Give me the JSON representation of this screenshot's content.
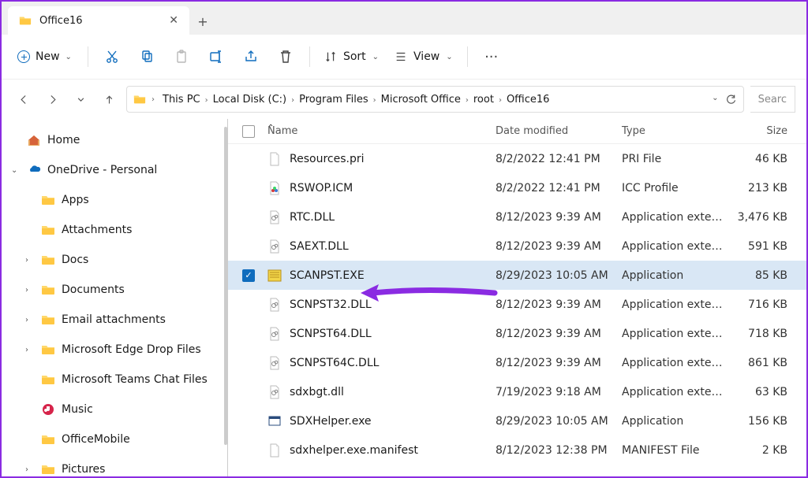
{
  "tab": {
    "title": "Office16"
  },
  "toolbar": {
    "new": "New",
    "sort": "Sort",
    "view": "View",
    "more": "···"
  },
  "breadcrumbs": [
    "This PC",
    "Local Disk (C:)",
    "Program Files",
    "Microsoft Office",
    "root",
    "Office16"
  ],
  "search_placeholder": "Searc",
  "columns": {
    "name": "Name",
    "date": "Date modified",
    "type": "Type",
    "size": "Size"
  },
  "sidebar": [
    {
      "label": "Home",
      "icon": "home",
      "indent": 0,
      "expand": ""
    },
    {
      "label": "OneDrive - Personal",
      "icon": "onedrive",
      "indent": 0,
      "expand": "v"
    },
    {
      "label": "Apps",
      "icon": "folder",
      "indent": 1,
      "expand": ""
    },
    {
      "label": "Attachments",
      "icon": "folder",
      "indent": 1,
      "expand": ""
    },
    {
      "label": "Docs",
      "icon": "folder",
      "indent": 1,
      "expand": ">"
    },
    {
      "label": "Documents",
      "icon": "folder",
      "indent": 1,
      "expand": ">"
    },
    {
      "label": "Email attachments",
      "icon": "folder",
      "indent": 1,
      "expand": ">"
    },
    {
      "label": "Microsoft Edge Drop Files",
      "icon": "folder",
      "indent": 1,
      "expand": ">"
    },
    {
      "label": "Microsoft Teams Chat Files",
      "icon": "folder",
      "indent": 1,
      "expand": ""
    },
    {
      "label": "Music",
      "icon": "music",
      "indent": 1,
      "expand": ""
    },
    {
      "label": "OfficeMobile",
      "icon": "folder",
      "indent": 1,
      "expand": ""
    },
    {
      "label": "Pictures",
      "icon": "folder",
      "indent": 1,
      "expand": ">"
    }
  ],
  "files": [
    {
      "name": "Resources.pri",
      "date": "8/2/2022 12:41 PM",
      "type": "PRI File",
      "size": "46 KB",
      "icon": "file",
      "selected": false
    },
    {
      "name": "RSWOP.ICM",
      "date": "8/2/2022 12:41 PM",
      "type": "ICC Profile",
      "size": "213 KB",
      "icon": "icc",
      "selected": false
    },
    {
      "name": "RTC.DLL",
      "date": "8/12/2023 9:39 AM",
      "type": "Application extens...",
      "size": "3,476 KB",
      "icon": "dll",
      "selected": false
    },
    {
      "name": "SAEXT.DLL",
      "date": "8/12/2023 9:39 AM",
      "type": "Application extens...",
      "size": "591 KB",
      "icon": "dll",
      "selected": false
    },
    {
      "name": "SCANPST.EXE",
      "date": "8/29/2023 10:05 AM",
      "type": "Application",
      "size": "85 KB",
      "icon": "exe-custom",
      "selected": true
    },
    {
      "name": "SCNPST32.DLL",
      "date": "8/12/2023 9:39 AM",
      "type": "Application extens...",
      "size": "716 KB",
      "icon": "dll",
      "selected": false
    },
    {
      "name": "SCNPST64.DLL",
      "date": "8/12/2023 9:39 AM",
      "type": "Application extens...",
      "size": "718 KB",
      "icon": "dll",
      "selected": false
    },
    {
      "name": "SCNPST64C.DLL",
      "date": "8/12/2023 9:39 AM",
      "type": "Application extens...",
      "size": "861 KB",
      "icon": "dll",
      "selected": false
    },
    {
      "name": "sdxbgt.dll",
      "date": "7/19/2023 9:18 AM",
      "type": "Application extens...",
      "size": "63 KB",
      "icon": "dll",
      "selected": false
    },
    {
      "name": "SDXHelper.exe",
      "date": "8/29/2023 10:05 AM",
      "type": "Application",
      "size": "156 KB",
      "icon": "exe",
      "selected": false
    },
    {
      "name": "sdxhelper.exe.manifest",
      "date": "8/12/2023 12:38 PM",
      "type": "MANIFEST File",
      "size": "2 KB",
      "icon": "file",
      "selected": false
    }
  ]
}
